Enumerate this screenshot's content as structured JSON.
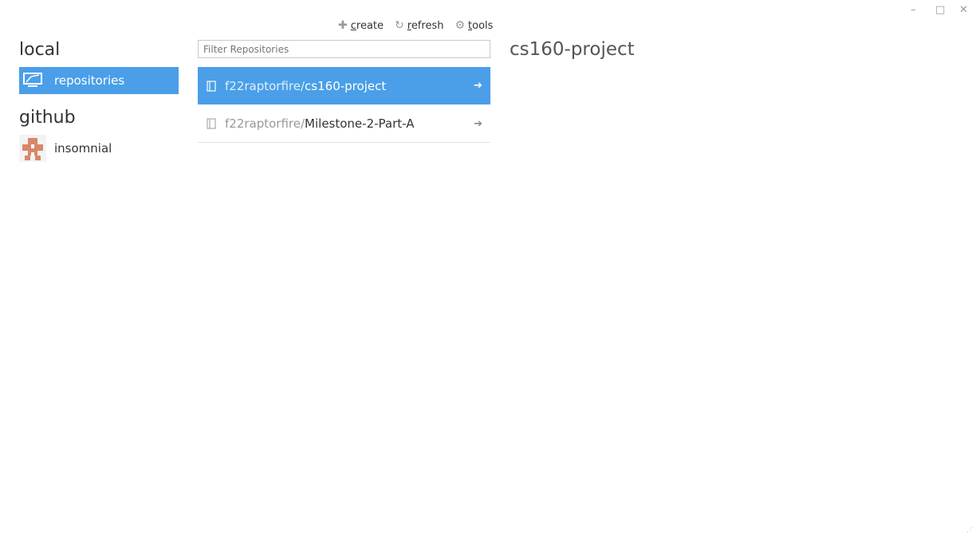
{
  "window_controls": {
    "minimize": "–",
    "maximize": "□",
    "close": "✕"
  },
  "toolbar": {
    "create": {
      "icon": "plus-icon",
      "label": "create"
    },
    "refresh": {
      "icon": "refresh-icon",
      "label": "refresh"
    },
    "tools": {
      "icon": "gear-icon",
      "label": "tools"
    }
  },
  "sidebar": {
    "local_heading": "local",
    "local_items": [
      {
        "label": "repositories",
        "icon": "monitor-icon"
      }
    ],
    "github_heading": "github",
    "github_items": [
      {
        "label": "insomnial",
        "icon": "avatar"
      }
    ]
  },
  "filter": {
    "placeholder": "Filter Repositories",
    "value": ""
  },
  "repos": [
    {
      "owner": "f22raptorfire/",
      "name": "cs160-project",
      "selected": true
    },
    {
      "owner": "f22raptorfire/",
      "name": "Milestone-2-Part-A",
      "selected": false
    }
  ],
  "detail": {
    "title": "cs160-project"
  },
  "colors": {
    "accent": "#4a9fe8",
    "avatar": "#d9876a"
  }
}
